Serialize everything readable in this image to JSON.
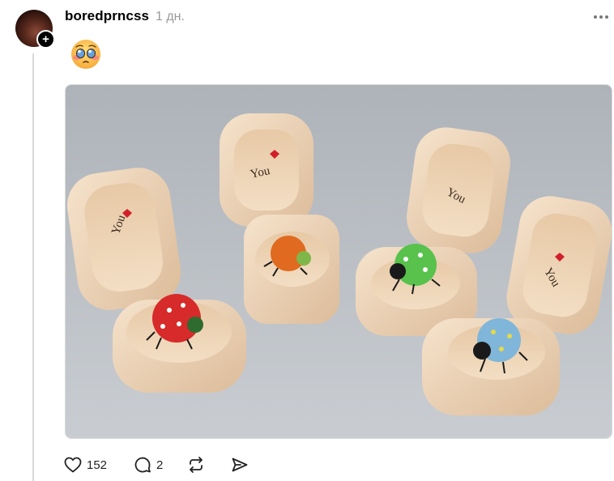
{
  "post": {
    "username": "boredprncss",
    "time": "1 дн.",
    "follow_symbol": "+",
    "emoji": "pleading-face"
  },
  "photo": {
    "subject": "four wooden boxes with painted ladybugs",
    "box_text": "You"
  },
  "actions": {
    "likes": "152",
    "replies": "2"
  },
  "colors": {
    "background": "#ffffff",
    "text": "#000000",
    "muted": "#999999",
    "thread_line": "#d9d9d9"
  }
}
